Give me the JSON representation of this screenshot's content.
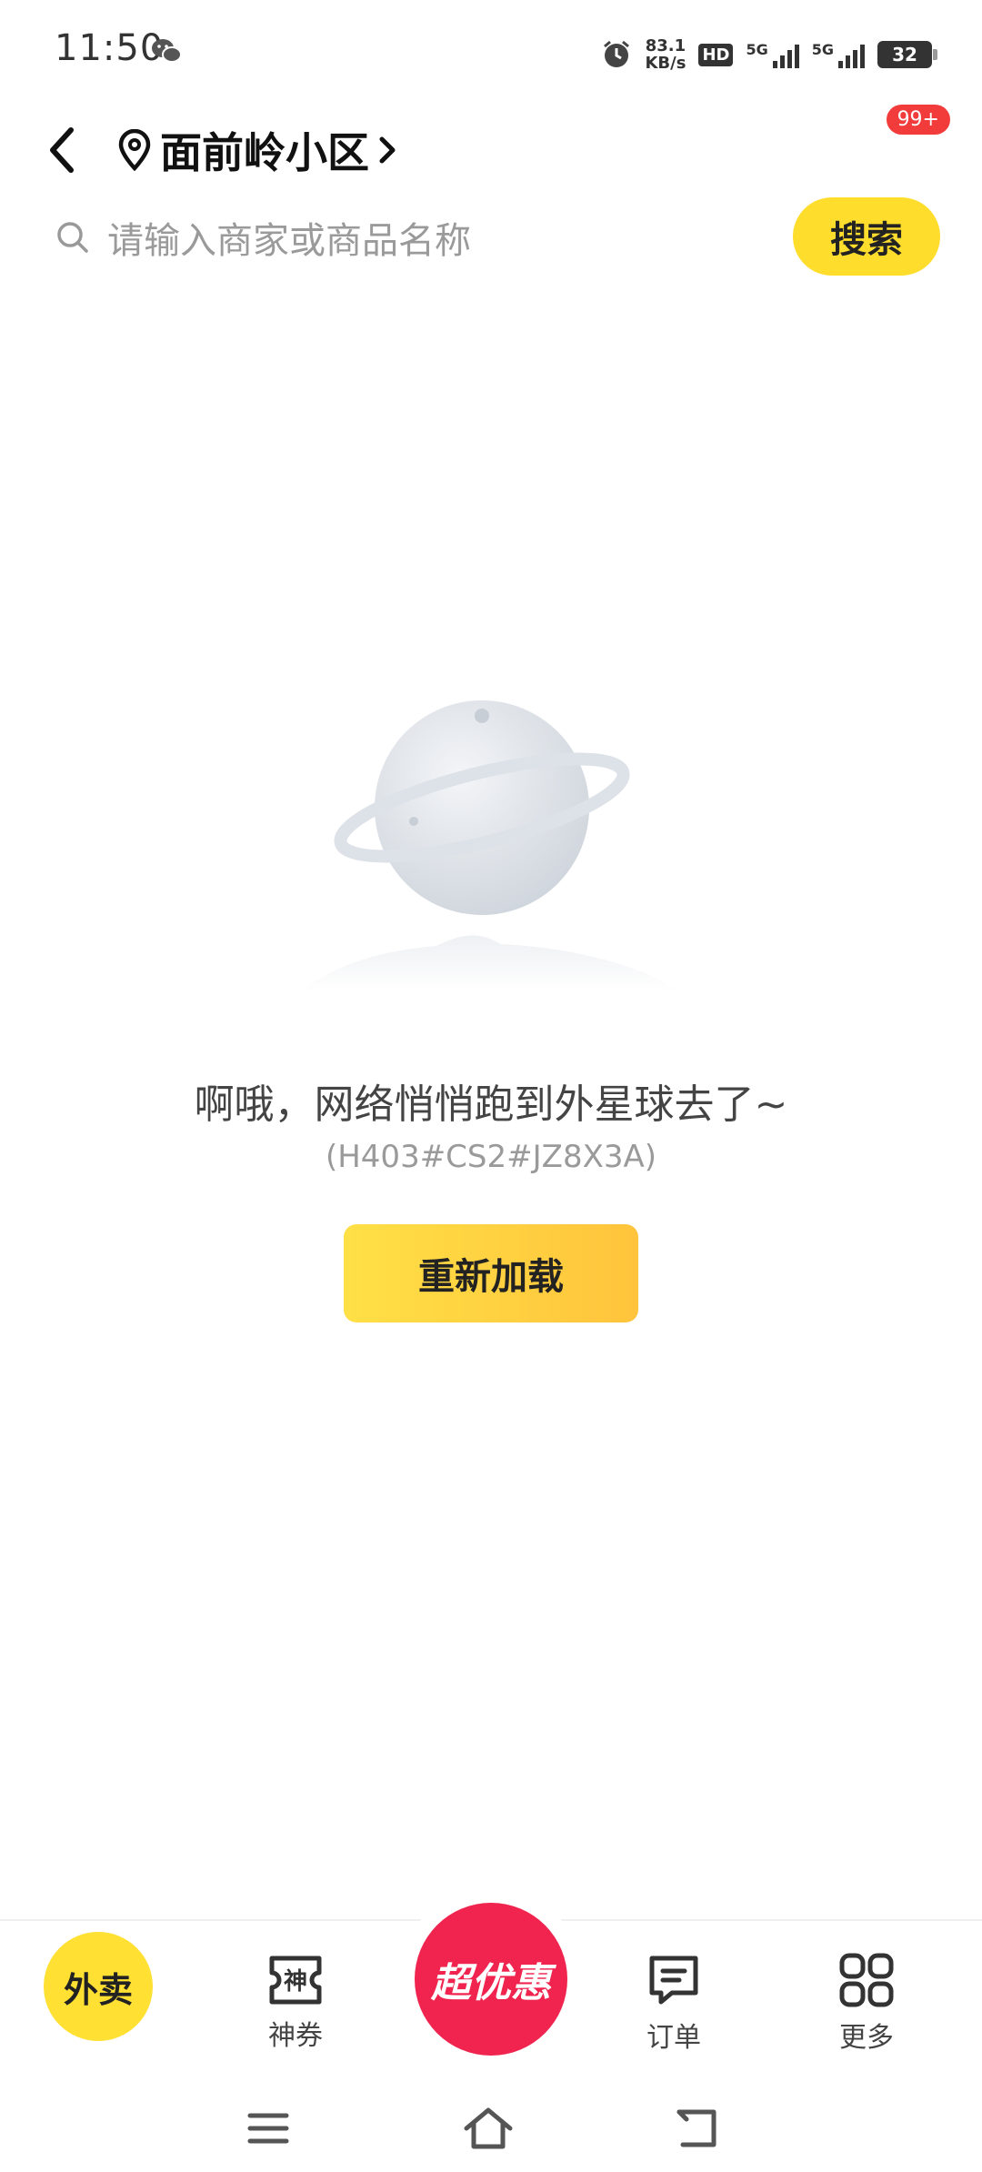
{
  "status_bar": {
    "time": "11:50",
    "net_speed_value": "83.1",
    "net_speed_unit": "KB/s",
    "hd_label": "HD",
    "signal1_label": "5G",
    "signal2_label": "5G",
    "battery_level": "32"
  },
  "header": {
    "location_name": "面前岭小区",
    "notification_badge": "99+"
  },
  "search": {
    "placeholder": "请输入商家或商品名称",
    "button_label": "搜索"
  },
  "error": {
    "message": "啊哦，网络悄悄跑到外星球去了~",
    "code": "(H403#CS2#JZ8X3A)",
    "reload_label": "重新加载"
  },
  "tabbar": {
    "waimai_label": "外卖",
    "coupon_label": "神券",
    "coupon_icon_glyph": "神",
    "center_label": "超优惠",
    "orders_label": "订单",
    "more_label": "更多"
  },
  "colors": {
    "accent_yellow": "#ffdd2d",
    "center_red": "#f0244e",
    "badge_red": "#f23b3b"
  }
}
